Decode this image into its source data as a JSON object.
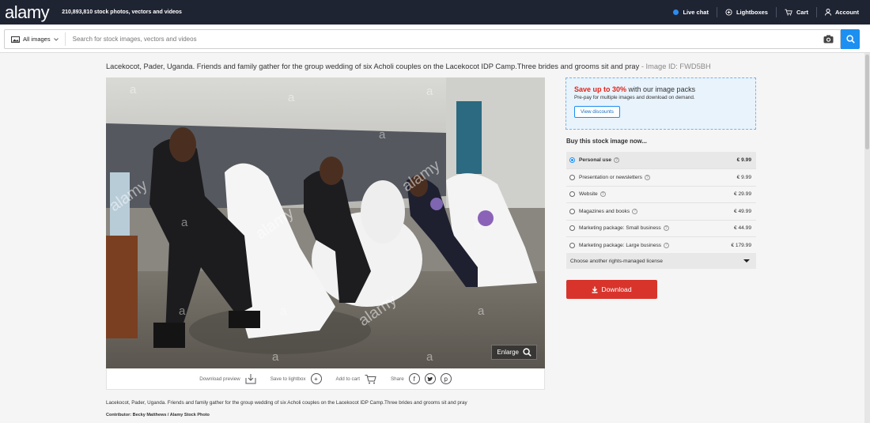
{
  "header": {
    "logo": "alamy",
    "tagline": "210,893,810 stock photos, vectors and videos",
    "nav": {
      "live_chat": "Live chat",
      "lightboxes": "Lightboxes",
      "cart": "Cart",
      "account": "Account"
    }
  },
  "search": {
    "type_label": "All images",
    "placeholder": "Search for stock images, vectors and videos"
  },
  "image": {
    "title": "Lacekocot, Pader, Uganda. Friends and family gather for the group wedding of six Acholi couples on the Lacekocot IDP Camp.Three brides and grooms sit and pray",
    "id_text": "- Image ID: FWD5BH",
    "enlarge_label": "Enlarge",
    "caption": "Lacekocot, Pader, Uganda. Friends and family gather for the group wedding of six Acholi couples on the Lacekocot IDP Camp.Three brides and grooms sit and pray",
    "contributor_label": "Contributor:",
    "contributor_value": "Becky Matthews / Alamy Stock Photo",
    "watermark": "alamy",
    "watermark_letter": "a"
  },
  "actions": {
    "download_preview": "Download preview",
    "save_to_lightbox": "Save to lightbox",
    "add_to_cart": "Add to cart",
    "share": "Share"
  },
  "promo": {
    "highlight": "Save up to 30%",
    "headline_rest": " with our image packs",
    "subtext": "Pre-pay for multiple images and download on demand.",
    "button": "View discounts"
  },
  "buy": {
    "title": "Buy this stock image now...",
    "options": [
      {
        "label": "Personal use",
        "price": "€ 9.99",
        "selected": true
      },
      {
        "label": "Presentation or newsletters",
        "price": "€ 9.99",
        "selected": false
      },
      {
        "label": "Website",
        "price": "€ 29.99",
        "selected": false
      },
      {
        "label": "Magazines and books",
        "price": "€ 49.99",
        "selected": false
      },
      {
        "label": "Marketing package: Small business",
        "price": "€ 44.99",
        "selected": false
      },
      {
        "label": "Marketing package: Large business",
        "price": "€ 179.99",
        "selected": false
      }
    ],
    "rights_managed": "Choose another rights-managed license",
    "download_button": "Download"
  },
  "colors": {
    "nav_bg": "#1f2433",
    "accent_blue": "#1c8ff0",
    "download_red": "#d8342b",
    "promo_red": "#e2231a"
  }
}
